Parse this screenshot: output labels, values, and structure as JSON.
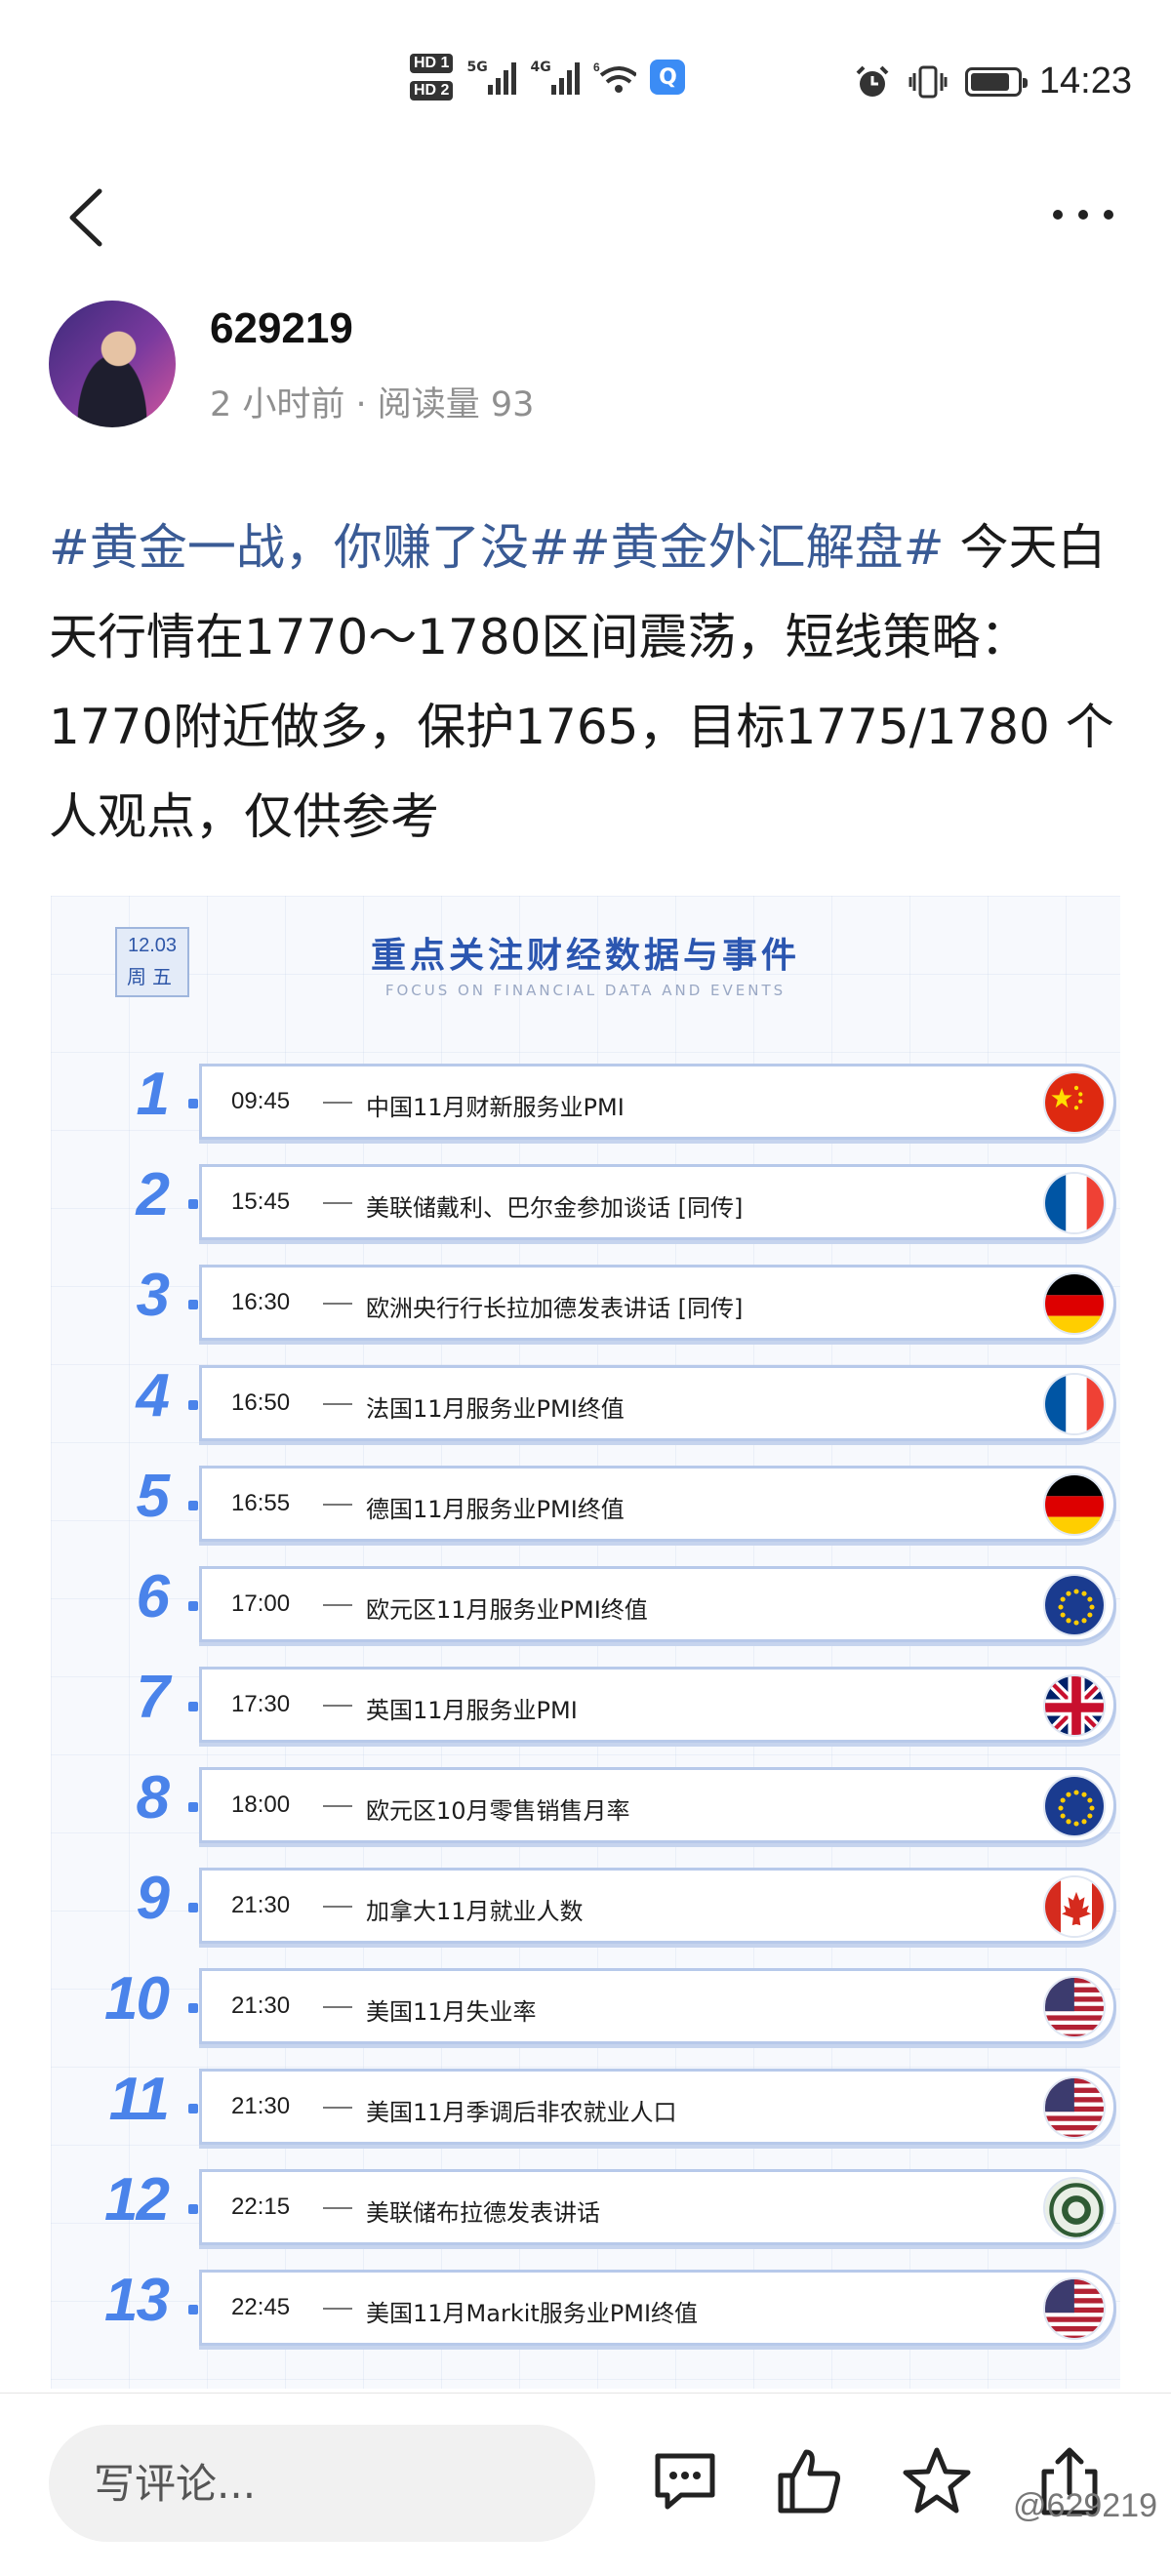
{
  "status_bar": {
    "hd1": "HD 1",
    "hd2": "HD 2",
    "net1": "5G",
    "net2": "4G",
    "wifi_badge": "6",
    "time": "14:23",
    "battery_level": 0.85
  },
  "author": {
    "name": "629219",
    "meta": "2 小时前 · 阅读量 93"
  },
  "post": {
    "hashtags": "#黄金一战，你赚了没##黄金外汇解盘#",
    "body": " 今天白天行情在1770～1780区间震荡，短线策略：1770附近做多，保护1765，目标1775/1780 个人观点，仅供参考"
  },
  "infographic": {
    "date": "12.03",
    "weekday": "周五",
    "title": "重点关注财经数据与事件",
    "subtitle": "FOCUS ON FINANCIAL DATA AND EVENTS",
    "rows": [
      {
        "num": "1",
        "time": "09:45",
        "text": "中国11月财新服务业PMI",
        "flag": "china-flag-icon"
      },
      {
        "num": "2",
        "time": "15:45",
        "text": "美联储戴利、巴尔金参加谈话 [同传]",
        "flag": "france-flag-icon"
      },
      {
        "num": "3",
        "time": "16:30",
        "text": "欧洲央行行长拉加德发表讲话 [同传]",
        "flag": "germany-flag-icon"
      },
      {
        "num": "4",
        "time": "16:50",
        "text": "法国11月服务业PMI终值",
        "flag": "france-flag-icon"
      },
      {
        "num": "5",
        "time": "16:55",
        "text": "德国11月服务业PMI终值",
        "flag": "germany-flag-icon"
      },
      {
        "num": "6",
        "time": "17:00",
        "text": "欧元区11月服务业PMI终值",
        "flag": "eu-flag-icon"
      },
      {
        "num": "7",
        "time": "17:30",
        "text": "英国11月服务业PMI",
        "flag": "uk-flag-icon"
      },
      {
        "num": "8",
        "time": "18:00",
        "text": "欧元区10月零售销售月率",
        "flag": "eu-flag-icon"
      },
      {
        "num": "9",
        "time": "21:30",
        "text": "加拿大11月就业人数",
        "flag": "canada-flag-icon"
      },
      {
        "num": "10",
        "time": "21:30",
        "text": "美国11月失业率",
        "flag": "usa-flag-icon"
      },
      {
        "num": "11",
        "time": "21:30",
        "text": "美国11月季调后非农就业人口",
        "flag": "usa-flag-icon"
      },
      {
        "num": "12",
        "time": "22:15",
        "text": "美联储布拉德发表讲话",
        "flag": "fed-seal-icon"
      },
      {
        "num": "13",
        "time": "22:45",
        "text": "美国11月Markit服务业PMI终值",
        "flag": "usa-flag-icon"
      }
    ]
  },
  "bottom_bar": {
    "comment_placeholder": "写评论...",
    "watermark": "@629219"
  },
  "colors": {
    "hashtag": "#3a5b95",
    "accent_blue": "#4a83ea",
    "title_blue": "#2b56b0"
  }
}
